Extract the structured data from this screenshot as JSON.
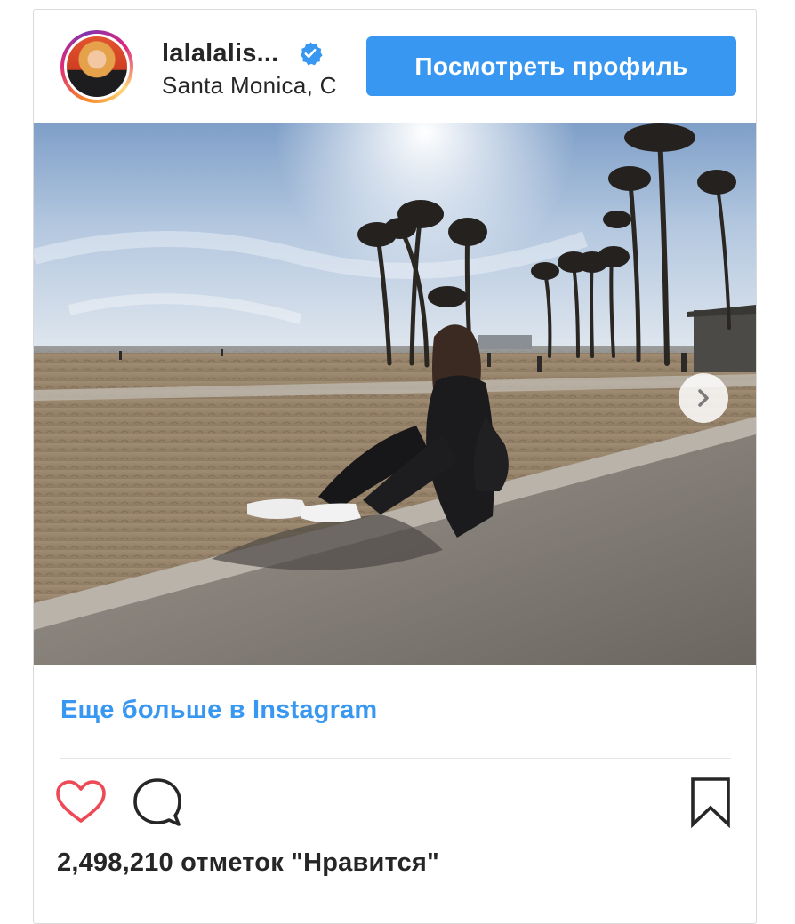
{
  "header": {
    "username": "lalalalis...",
    "location": "Santa Monica, C",
    "view_profile_label": "Посмотреть профиль"
  },
  "post": {
    "more_link_label": "Еще больше в Instagram",
    "likes_text": "2,498,210 отметок \"Нравится\""
  },
  "icons": {
    "verified": "verified-badge-icon",
    "next": "chevron-right-icon",
    "like": "heart-outline-icon",
    "comment": "comment-bubble-icon",
    "save": "bookmark-icon"
  },
  "colors": {
    "accent": "#3897f0",
    "like_heart": "#ed4956",
    "text": "#262626",
    "border": "#dbdbdb"
  }
}
